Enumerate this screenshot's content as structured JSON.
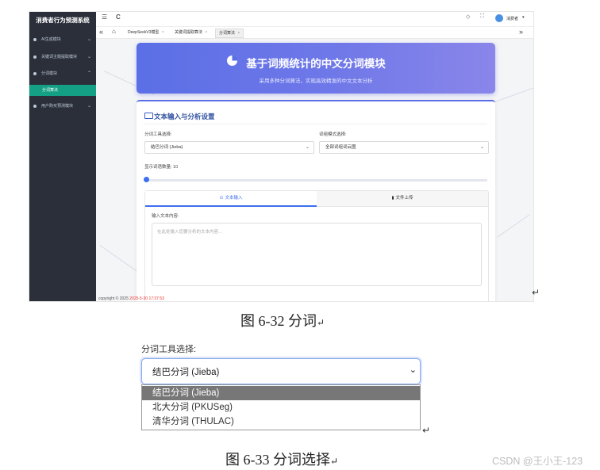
{
  "app": {
    "system_title": "消费者行为预测系统",
    "sidebar": [
      {
        "label": "AI生成模块",
        "chev": "⌄"
      },
      {
        "label": "关键词主题提取模块",
        "chev": "⌄"
      },
      {
        "label": "分词模块",
        "chev": "⌃"
      },
      {
        "label": "用户购买预测模块",
        "chev": "⌄"
      }
    ],
    "sidebar_active": "分词算法",
    "topbar": {
      "menu_icon": "☰",
      "refresh_icon": "C",
      "user_name": "消费者",
      "user_caret": "▾"
    },
    "tabs": [
      {
        "label": "DeepSeekV3模型",
        "close": "×"
      },
      {
        "label": "关键词提取算法",
        "close": "×"
      },
      {
        "label": "分词算法",
        "close": "×"
      }
    ],
    "hero": {
      "title": "基于词频统计的中文分词模块",
      "subtitle": "采用多种分词算法，实现高效精准的中文文本分析"
    },
    "card": {
      "title": "文本输入与分析设置",
      "tool_label": "分词工具选择:",
      "tool_value": "结巴分词 (Jieba)",
      "mode_label": "词组模式选择:",
      "mode_value": "全部词组词云图",
      "count_label": "显示词语数量: 10",
      "slider_fraction": 0,
      "tab_text": "文本输入",
      "tab_file": "文件上传",
      "textarea_label": "输入文本内容:",
      "textarea_placeholder": "在此处输入您要分析的文本内容..."
    },
    "copyright_prefix": "copyright © 2025",
    "copyright_date": "2025-5-30 17:37:53"
  },
  "caption1": "图 6-32 分词",
  "caption2": "图 6-33 分词选择",
  "return_mark": "↵",
  "dropdown": {
    "label": "分词工具选择:",
    "selected": "结巴分词 (Jieba)",
    "arrow": "⌄",
    "options": [
      "结巴分词 (Jieba)",
      "北大分词 (PKUSeg)",
      "清华分词 (THULAC)"
    ],
    "highlighted_index": 0
  },
  "watermark": "CSDN @王小王-123",
  "colors": {
    "sidebar_bg": "#2b2f3a",
    "active_green": "#14a085",
    "hero_blue": "#5b6fe6",
    "accent": "#3d6ef0",
    "option_highlight": "#777777"
  }
}
